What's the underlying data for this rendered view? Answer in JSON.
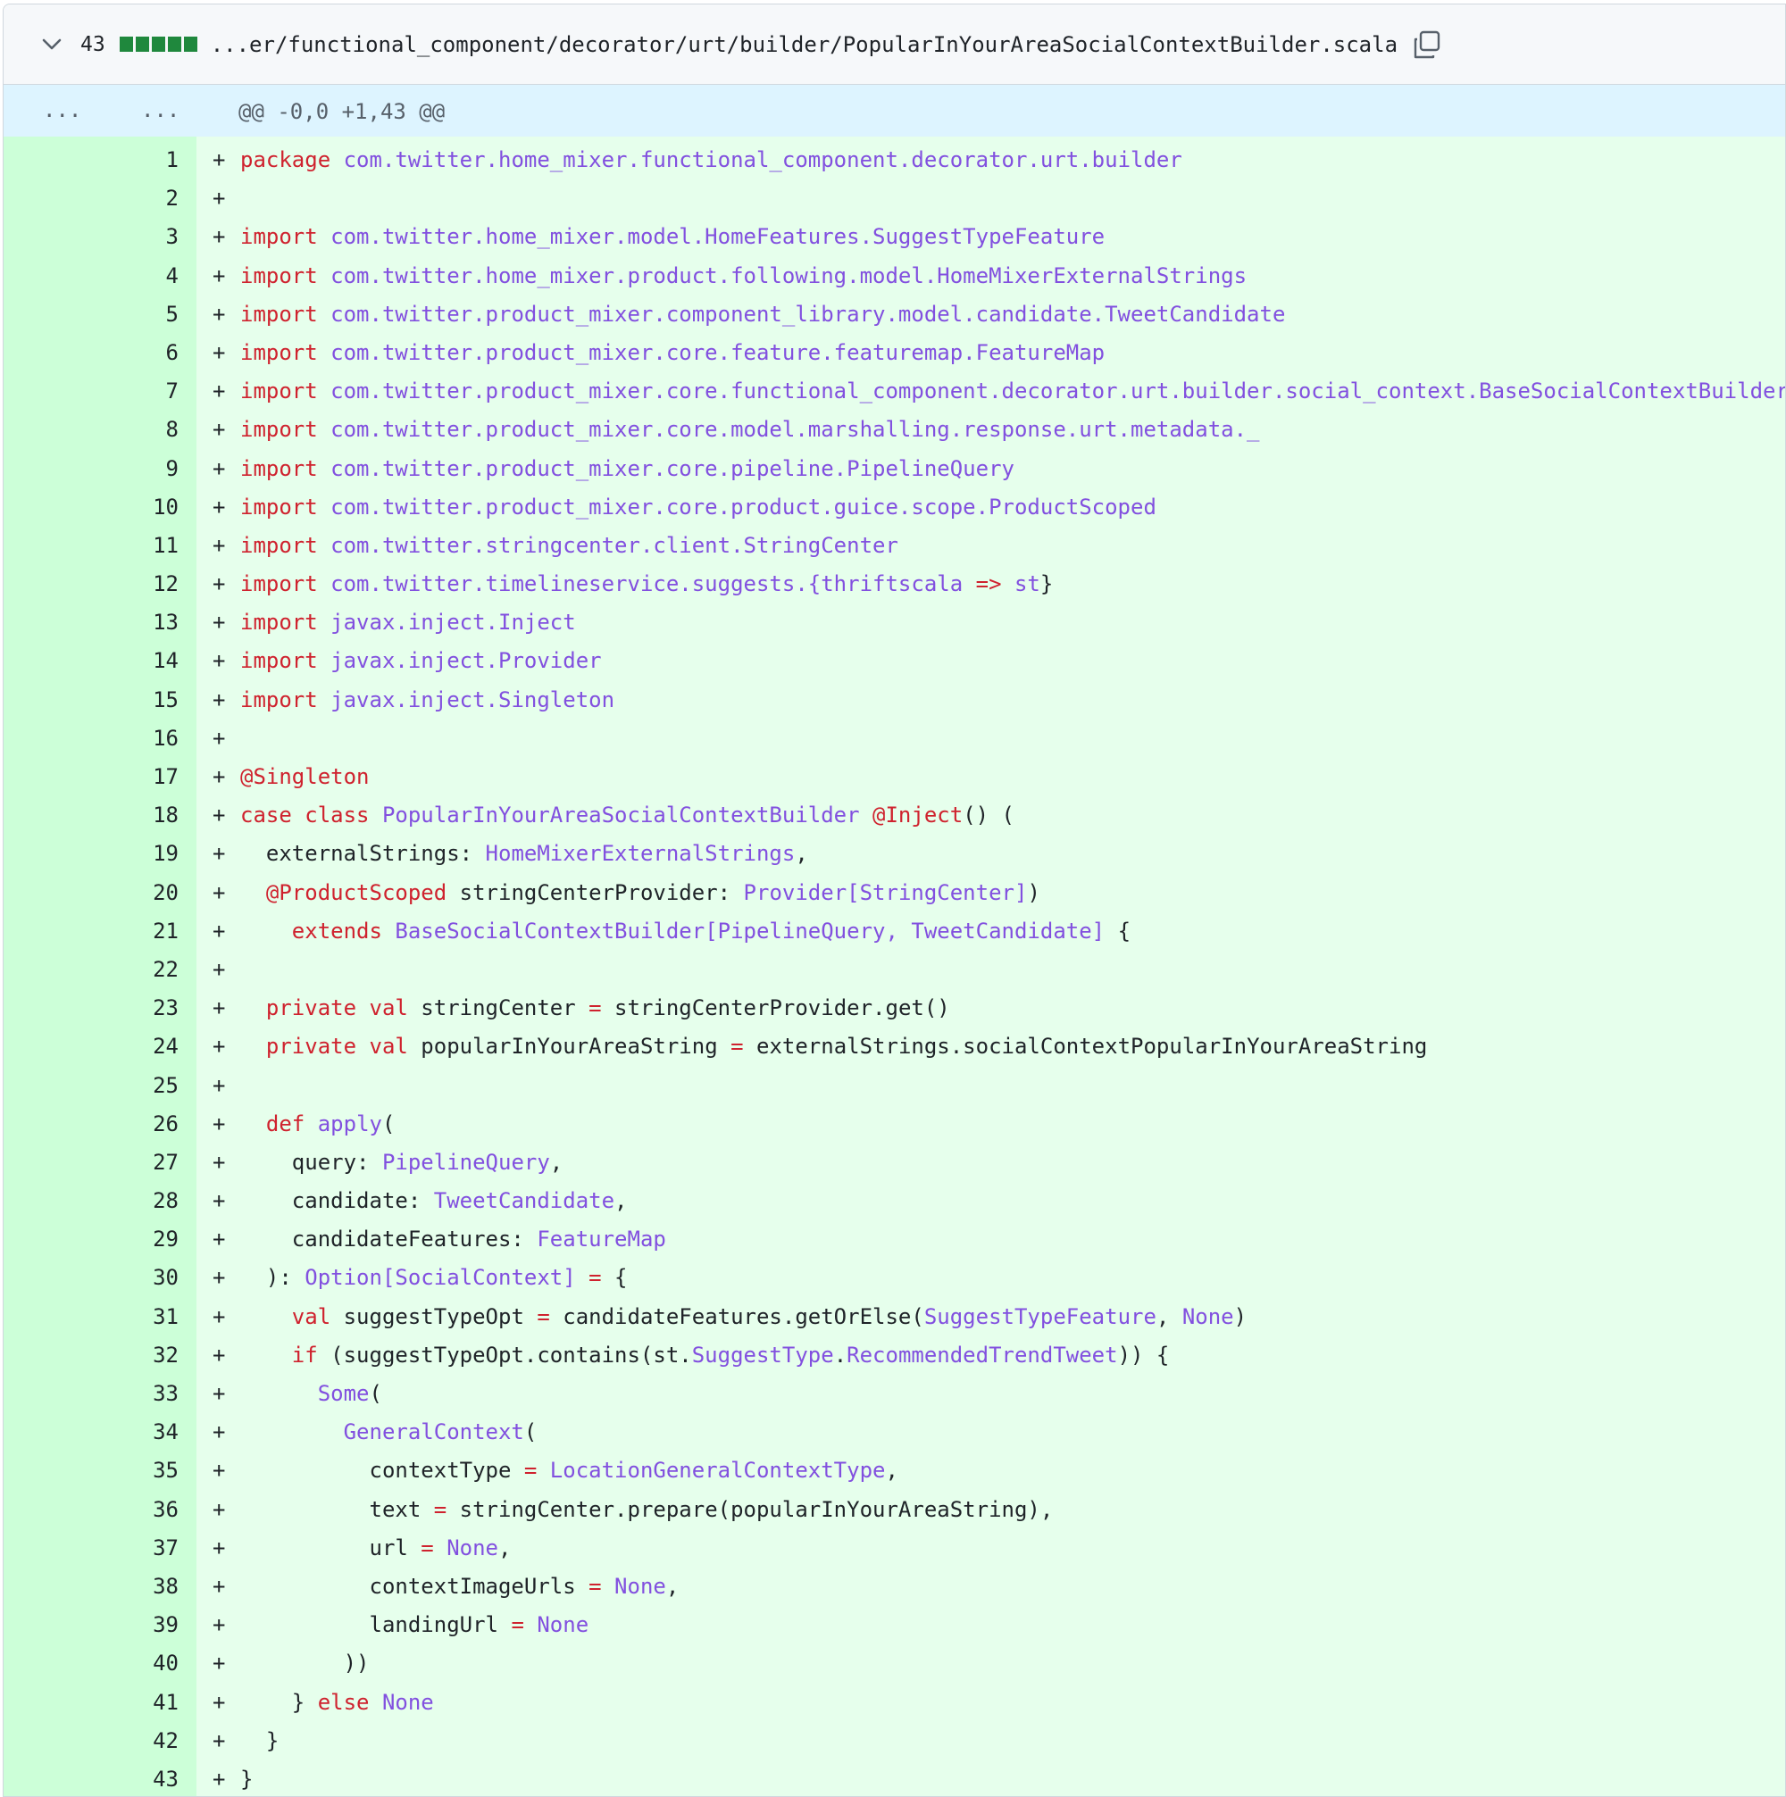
{
  "file": {
    "changes": "43",
    "path": "...er/functional_component/decorator/urt/builder/PopularInYourAreaSocialContextBuilder.scala",
    "icons": {
      "toggle": "chevron-down-icon",
      "copy": "copy-icon"
    },
    "colors": {
      "added_bg": "#e6ffec",
      "added_gutter": "#ccffd8",
      "hunk_bg": "#ddf4ff",
      "diffstat": "#1f883d",
      "keyword": "#cf222e",
      "entity": "#8250df"
    }
  },
  "hunk": {
    "left": "...",
    "right": "...",
    "header": "@@ -0,0 +1,43 @@"
  },
  "lines": [
    {
      "n": "1",
      "tokens": [
        [
          "k",
          "package"
        ],
        [
          "t",
          " "
        ],
        [
          "e",
          "com.twitter.home_mixer.functional_component.decorator.urt.builder"
        ]
      ]
    },
    {
      "n": "2",
      "tokens": []
    },
    {
      "n": "3",
      "tokens": [
        [
          "k",
          "import"
        ],
        [
          "t",
          " "
        ],
        [
          "e",
          "com.twitter.home_mixer.model.HomeFeatures.SuggestTypeFeature"
        ]
      ]
    },
    {
      "n": "4",
      "tokens": [
        [
          "k",
          "import"
        ],
        [
          "t",
          " "
        ],
        [
          "e",
          "com.twitter.home_mixer.product.following.model.HomeMixerExternalStrings"
        ]
      ]
    },
    {
      "n": "5",
      "tokens": [
        [
          "k",
          "import"
        ],
        [
          "t",
          " "
        ],
        [
          "e",
          "com.twitter.product_mixer.component_library.model.candidate.TweetCandidate"
        ]
      ]
    },
    {
      "n": "6",
      "tokens": [
        [
          "k",
          "import"
        ],
        [
          "t",
          " "
        ],
        [
          "e",
          "com.twitter.product_mixer.core.feature.featuremap.FeatureMap"
        ]
      ]
    },
    {
      "n": "7",
      "tokens": [
        [
          "k",
          "import"
        ],
        [
          "t",
          " "
        ],
        [
          "e",
          "com.twitter.product_mixer.core.functional_component.decorator.urt.builder.social_context.BaseSocialContextBuilder"
        ]
      ]
    },
    {
      "n": "8",
      "tokens": [
        [
          "k",
          "import"
        ],
        [
          "t",
          " "
        ],
        [
          "e",
          "com.twitter.product_mixer.core.model.marshalling.response.urt.metadata._"
        ]
      ]
    },
    {
      "n": "9",
      "tokens": [
        [
          "k",
          "import"
        ],
        [
          "t",
          " "
        ],
        [
          "e",
          "com.twitter.product_mixer.core.pipeline.PipelineQuery"
        ]
      ]
    },
    {
      "n": "10",
      "tokens": [
        [
          "k",
          "import"
        ],
        [
          "t",
          " "
        ],
        [
          "e",
          "com.twitter.product_mixer.core.product.guice.scope.ProductScoped"
        ]
      ]
    },
    {
      "n": "11",
      "tokens": [
        [
          "k",
          "import"
        ],
        [
          "t",
          " "
        ],
        [
          "e",
          "com.twitter.stringcenter.client.StringCenter"
        ]
      ]
    },
    {
      "n": "12",
      "tokens": [
        [
          "k",
          "import"
        ],
        [
          "t",
          " "
        ],
        [
          "e",
          "com.twitter.timelineservice.suggests.{thriftscala "
        ],
        [
          "k",
          "=>"
        ],
        [
          "e",
          " st"
        ],
        [
          "t",
          "}"
        ]
      ]
    },
    {
      "n": "13",
      "tokens": [
        [
          "k",
          "import"
        ],
        [
          "t",
          " "
        ],
        [
          "e",
          "javax.inject.Inject"
        ]
      ]
    },
    {
      "n": "14",
      "tokens": [
        [
          "k",
          "import"
        ],
        [
          "t",
          " "
        ],
        [
          "e",
          "javax.inject.Provider"
        ]
      ]
    },
    {
      "n": "15",
      "tokens": [
        [
          "k",
          "import"
        ],
        [
          "t",
          " "
        ],
        [
          "e",
          "javax.inject.Singleton"
        ]
      ]
    },
    {
      "n": "16",
      "tokens": []
    },
    {
      "n": "17",
      "tokens": [
        [
          "k",
          "@Singleton"
        ]
      ]
    },
    {
      "n": "18",
      "tokens": [
        [
          "k",
          "case class"
        ],
        [
          "t",
          " "
        ],
        [
          "e",
          "PopularInYourAreaSocialContextBuilder"
        ],
        [
          "t",
          " "
        ],
        [
          "k",
          "@Inject"
        ],
        [
          "t",
          "() ("
        ]
      ]
    },
    {
      "n": "19",
      "tokens": [
        [
          "t",
          "  externalStrings: "
        ],
        [
          "e",
          "HomeMixerExternalStrings"
        ],
        [
          "t",
          ","
        ]
      ]
    },
    {
      "n": "20",
      "tokens": [
        [
          "t",
          "  "
        ],
        [
          "k",
          "@ProductScoped"
        ],
        [
          "t",
          " stringCenterProvider: "
        ],
        [
          "e",
          "Provider[StringCenter]"
        ],
        [
          "t",
          ")"
        ]
      ]
    },
    {
      "n": "21",
      "tokens": [
        [
          "t",
          "    "
        ],
        [
          "k",
          "extends"
        ],
        [
          "t",
          " "
        ],
        [
          "e",
          "BaseSocialContextBuilder[PipelineQuery, TweetCandidate]"
        ],
        [
          "t",
          " {"
        ]
      ]
    },
    {
      "n": "22",
      "tokens": []
    },
    {
      "n": "23",
      "tokens": [
        [
          "t",
          "  "
        ],
        [
          "k",
          "private val"
        ],
        [
          "t",
          " stringCenter "
        ],
        [
          "k",
          "="
        ],
        [
          "t",
          " stringCenterProvider.get()"
        ]
      ]
    },
    {
      "n": "24",
      "tokens": [
        [
          "t",
          "  "
        ],
        [
          "k",
          "private val"
        ],
        [
          "t",
          " popularInYourAreaString "
        ],
        [
          "k",
          "="
        ],
        [
          "t",
          " externalStrings.socialContextPopularInYourAreaString"
        ]
      ]
    },
    {
      "n": "25",
      "tokens": []
    },
    {
      "n": "26",
      "tokens": [
        [
          "t",
          "  "
        ],
        [
          "k",
          "def"
        ],
        [
          "t",
          " "
        ],
        [
          "e",
          "apply"
        ],
        [
          "t",
          "("
        ]
      ]
    },
    {
      "n": "27",
      "tokens": [
        [
          "t",
          "    query: "
        ],
        [
          "e",
          "PipelineQuery"
        ],
        [
          "t",
          ","
        ]
      ]
    },
    {
      "n": "28",
      "tokens": [
        [
          "t",
          "    candidate: "
        ],
        [
          "e",
          "TweetCandidate"
        ],
        [
          "t",
          ","
        ]
      ]
    },
    {
      "n": "29",
      "tokens": [
        [
          "t",
          "    candidateFeatures: "
        ],
        [
          "e",
          "FeatureMap"
        ]
      ]
    },
    {
      "n": "30",
      "tokens": [
        [
          "t",
          "  ): "
        ],
        [
          "e",
          "Option[SocialContext]"
        ],
        [
          "t",
          " "
        ],
        [
          "k",
          "="
        ],
        [
          "t",
          " {"
        ]
      ]
    },
    {
      "n": "31",
      "tokens": [
        [
          "t",
          "    "
        ],
        [
          "k",
          "val"
        ],
        [
          "t",
          " suggestTypeOpt "
        ],
        [
          "k",
          "="
        ],
        [
          "t",
          " candidateFeatures.getOrElse("
        ],
        [
          "e",
          "SuggestTypeFeature"
        ],
        [
          "t",
          ", "
        ],
        [
          "e",
          "None"
        ],
        [
          "t",
          ")"
        ]
      ]
    },
    {
      "n": "32",
      "tokens": [
        [
          "t",
          "    "
        ],
        [
          "k",
          "if"
        ],
        [
          "t",
          " (suggestTypeOpt.contains(st."
        ],
        [
          "e",
          "SuggestType"
        ],
        [
          "t",
          "."
        ],
        [
          "e",
          "RecommendedTrendTweet"
        ],
        [
          "t",
          ")) {"
        ]
      ]
    },
    {
      "n": "33",
      "tokens": [
        [
          "t",
          "      "
        ],
        [
          "e",
          "Some"
        ],
        [
          "t",
          "("
        ]
      ]
    },
    {
      "n": "34",
      "tokens": [
        [
          "t",
          "        "
        ],
        [
          "e",
          "GeneralContext"
        ],
        [
          "t",
          "("
        ]
      ]
    },
    {
      "n": "35",
      "tokens": [
        [
          "t",
          "          contextType "
        ],
        [
          "k",
          "="
        ],
        [
          "t",
          " "
        ],
        [
          "e",
          "LocationGeneralContextType"
        ],
        [
          "t",
          ","
        ]
      ]
    },
    {
      "n": "36",
      "tokens": [
        [
          "t",
          "          text "
        ],
        [
          "k",
          "="
        ],
        [
          "t",
          " stringCenter.prepare(popularInYourAreaString),"
        ]
      ]
    },
    {
      "n": "37",
      "tokens": [
        [
          "t",
          "          url "
        ],
        [
          "k",
          "="
        ],
        [
          "t",
          " "
        ],
        [
          "e",
          "None"
        ],
        [
          "t",
          ","
        ]
      ]
    },
    {
      "n": "38",
      "tokens": [
        [
          "t",
          "          contextImageUrls "
        ],
        [
          "k",
          "="
        ],
        [
          "t",
          " "
        ],
        [
          "e",
          "None"
        ],
        [
          "t",
          ","
        ]
      ]
    },
    {
      "n": "39",
      "tokens": [
        [
          "t",
          "          landingUrl "
        ],
        [
          "k",
          "="
        ],
        [
          "t",
          " "
        ],
        [
          "e",
          "None"
        ]
      ]
    },
    {
      "n": "40",
      "tokens": [
        [
          "t",
          "        ))"
        ]
      ]
    },
    {
      "n": "41",
      "tokens": [
        [
          "t",
          "    } "
        ],
        [
          "k",
          "else"
        ],
        [
          "t",
          " "
        ],
        [
          "e",
          "None"
        ]
      ]
    },
    {
      "n": "42",
      "tokens": [
        [
          "t",
          "  }"
        ]
      ]
    },
    {
      "n": "43",
      "tokens": [
        [
          "t",
          "}"
        ]
      ]
    }
  ]
}
